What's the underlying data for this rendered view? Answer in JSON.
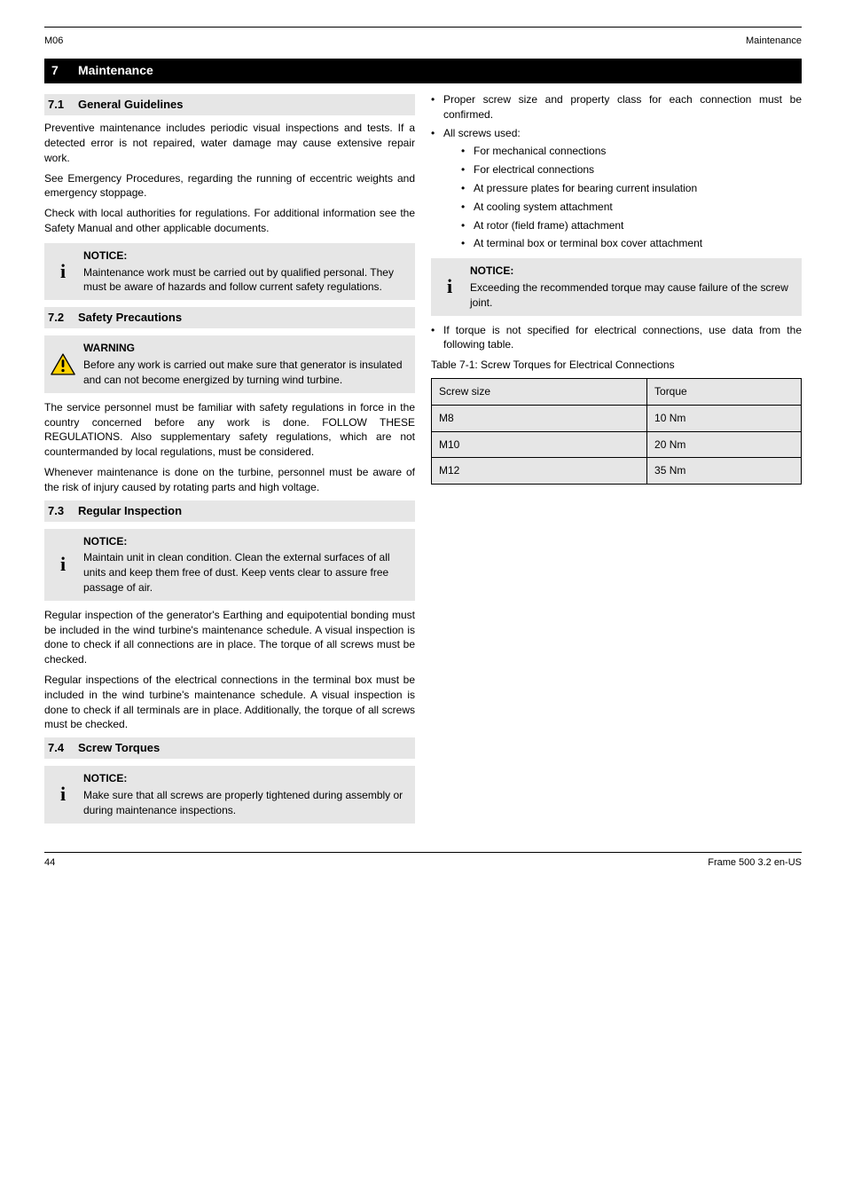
{
  "header": {
    "left": "M06",
    "right": "Maintenance"
  },
  "section": {
    "num": "7",
    "title": "Maintenance"
  },
  "left_col": {
    "s71": {
      "num": "7.1",
      "title": "General Guidelines",
      "p1": "Preventive maintenance includes periodic visual inspections and tests. If a detected error is not repaired, water damage may cause extensive repair work.",
      "p2": "See Emergency Procedures, regarding the running of eccentric weights and emergency stoppage.",
      "p3": "Check with local authorities for regulations. For additional information see the Safety Manual and other applicable documents."
    },
    "note1": {
      "title": "NOTICE:",
      "body": "Maintenance work must be carried out by qualified personal. They must be aware of hazards and follow current safety regulations."
    },
    "s72": {
      "num": "7.2",
      "title": "Safety Precautions"
    },
    "warn": {
      "title": "WARNING",
      "body": "Before any work is carried out make sure that generator is insulated and can not become energized by turning wind turbine."
    },
    "p_after_warn_1": "The service personnel must be familiar with safety regulations in force in the country concerned before any work is done. FOLLOW THESE REGULATIONS. Also supplementary safety regulations, which are not countermanded by local regulations, must be considered.",
    "p_after_warn_2": "Whenever maintenance is done on the turbine, personnel must be aware of the risk of injury caused by rotating parts and high voltage.",
    "s73": {
      "num": "7.3",
      "title": "Regular Inspection"
    },
    "note2": {
      "title": "NOTICE:",
      "body": "Maintain unit in clean condition. Clean the external surfaces of all units and keep them free of dust. Keep vents clear to assure free passage of air."
    },
    "p_after_note2_1": "Regular inspection of the generator's Earthing and equipotential bonding must be included in the wind turbine's maintenance schedule. A visual inspection is done to check if all connections are in place. The torque of all screws must be checked.",
    "p_after_note2_2": "Regular inspections of the electrical connections in the terminal box must be included in the wind turbine's maintenance schedule. A visual inspection is done to check if all terminals are in place. Additionally, the torque of all screws must be checked.",
    "s74": {
      "num": "7.4",
      "title": "Screw Torques"
    },
    "note3": {
      "title": "NOTICE:",
      "body": "Make sure that all screws are properly tightened during assembly or during maintenance inspections."
    }
  },
  "right_col": {
    "bullets_top": [
      "Proper screw size and property class for each connection must be confirmed.",
      "All screws used:"
    ],
    "bullets_nested": [
      "For mechanical connections",
      "For electrical connections",
      "At pressure plates for bearing current insulation",
      "At cooling system attachment",
      "At rotor (field frame) attachment",
      "At terminal box or terminal box cover attachment"
    ],
    "note4": {
      "title": "NOTICE:",
      "body": "Exceeding the recommended torque may cause failure of the screw joint."
    },
    "bullet_after_note": "If torque is not specified for electrical connections, use data from the following table.",
    "table_caption": "Table 7-1: Screw Torques for Electrical Connections",
    "table": {
      "headers": [
        "Screw size",
        "Torque"
      ],
      "rows": [
        [
          "M8",
          "10 Nm"
        ],
        [
          "M10",
          "20 Nm"
        ],
        [
          "M12",
          "35 Nm"
        ]
      ]
    }
  },
  "footer": {
    "left": "44",
    "right": "Frame 500 3.2 en-US"
  }
}
